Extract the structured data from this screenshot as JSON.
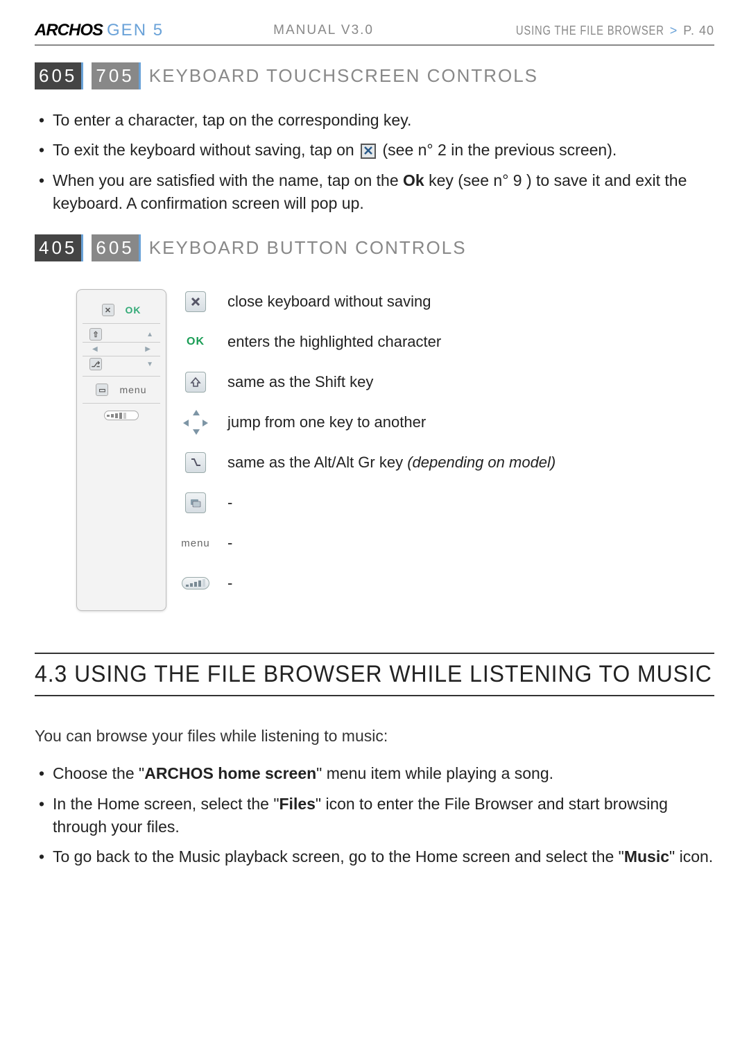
{
  "header": {
    "brand": "ARCHOS",
    "gen": "GEN 5",
    "manual": "MANUAL",
    "version": "V3.0",
    "breadcrumb": "USING THE FILE BROWSER",
    "page": "P. 40"
  },
  "section1": {
    "badges": [
      "605",
      "705"
    ],
    "title": "KEYBOARD TOUCHSCREEN CONTROLS",
    "bullets": {
      "b1": "To enter a character, tap on the corresponding key.",
      "b2_pre": "To exit the keyboard without saving, tap on ",
      "b2_post_a": " (see n° ",
      "b2_ref": "2",
      "b2_post_b": " in the previous screen).",
      "b3_pre": "When you are satisfied with the name, tap on the ",
      "b3_bold": "Ok",
      "b3_mid": " key (see n° ",
      "b3_ref": "9",
      "b3_post": ") to save it and exit the keyboard. A confirmation screen will pop up."
    }
  },
  "section2": {
    "badges": [
      "405",
      "605"
    ],
    "title": "KEYBOARD BUTTON CONTROLS",
    "remote": {
      "ok": "OK",
      "menu": "menu"
    },
    "legend": [
      {
        "icon": "close",
        "text": "close keyboard without saving"
      },
      {
        "icon": "ok",
        "text": "enters the highlighted character"
      },
      {
        "icon": "shift",
        "text": "same as the Shift key"
      },
      {
        "icon": "dpad",
        "text": "jump from one key to another"
      },
      {
        "icon": "alt",
        "text_pre": "same as the Alt/Alt Gr key ",
        "text_italic": "(depending on model)"
      },
      {
        "icon": "screen",
        "text": "-"
      },
      {
        "icon": "menu",
        "text": "-"
      },
      {
        "icon": "volume",
        "text": "-"
      }
    ]
  },
  "section3": {
    "title": "4.3  USING THE FILE BROWSER WHILE LISTENING TO MUSIC",
    "intro": "You can browse your files while listening to music:",
    "bullets": {
      "b1_pre": "Choose the \"",
      "b1_bold": "ARCHOS home screen",
      "b1_post": "\" menu item while playing a song.",
      "b2_pre": "In the Home screen, select the \"",
      "b2_bold": "Files",
      "b2_post": "\" icon to enter the File Browser and start browsing through your files.",
      "b3_pre": "To go back to the Music playback screen, go to the Home screen and select the \"",
      "b3_bold": "Music",
      "b3_post": "\" icon."
    }
  }
}
